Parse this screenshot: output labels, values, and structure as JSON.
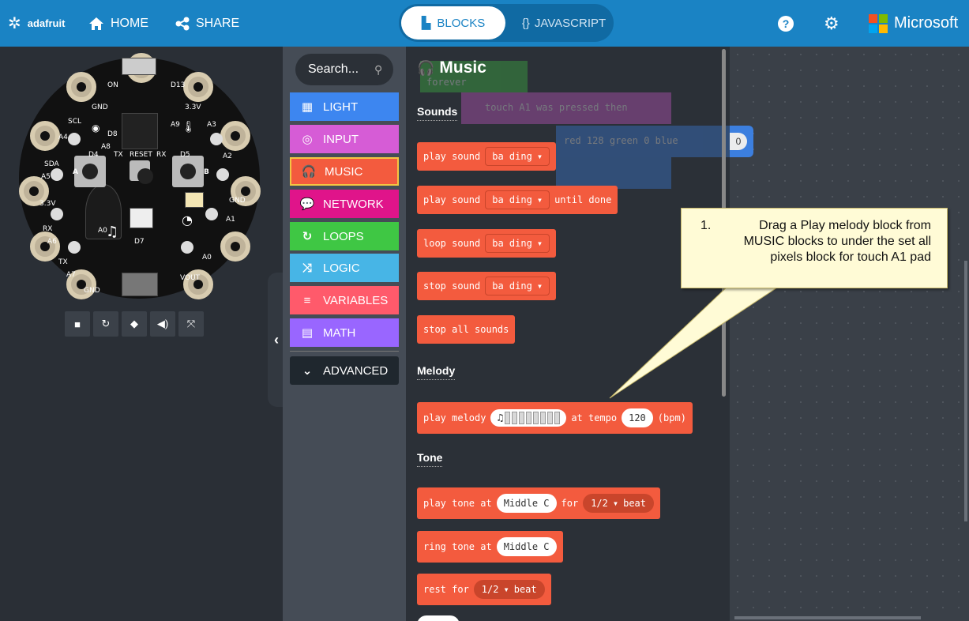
{
  "header": {
    "logo_text": "adafruit",
    "home_label": "HOME",
    "share_label": "SHARE",
    "blocks_tab": "BLOCKS",
    "javascript_tab": "JAVASCRIPT",
    "brand": "Microsoft",
    "colors": {
      "bar": "#1a83c4",
      "ms_red": "#f25022",
      "ms_green": "#7fba00",
      "ms_blue": "#00a4ef",
      "ms_yellow": "#ffb900"
    }
  },
  "simulator": {
    "labels": [
      "GND",
      "D8",
      "SCL",
      "A4",
      "SDA",
      "A5",
      "3.3V",
      "RX",
      "A6",
      "TX",
      "A7",
      "GND",
      "ON",
      "D13",
      "3.3V",
      "A3",
      "A2",
      "GND",
      "A1",
      "A0",
      "VOUT",
      "D4",
      "D5",
      "A8",
      "A9",
      "TX",
      "RESET",
      "RX",
      "A",
      "B",
      "D7",
      "A0"
    ],
    "controls": [
      "stop-icon",
      "restart-icon",
      "debug-icon",
      "sound-icon",
      "fullscreen-icon"
    ]
  },
  "toolbox": {
    "search_placeholder": "Search...",
    "categories": [
      {
        "label": "LIGHT",
        "icon": "grid-icon",
        "color": "#3d86f0"
      },
      {
        "label": "INPUT",
        "icon": "target-icon",
        "color": "#d65cd6"
      },
      {
        "label": "MUSIC",
        "icon": "headphones-icon",
        "color": "#f35b3e"
      },
      {
        "label": "NETWORK",
        "icon": "chat-icon",
        "color": "#e0148a"
      },
      {
        "label": "LOOPS",
        "icon": "loop-icon",
        "color": "#3fc744"
      },
      {
        "label": "LOGIC",
        "icon": "shuffle-icon",
        "color": "#47b5e6"
      },
      {
        "label": "VARIABLES",
        "icon": "list-icon",
        "color": "#ff5a6b"
      },
      {
        "label": "MATH",
        "icon": "calculator-icon",
        "color": "#9966ff"
      }
    ],
    "advanced_label": "ADVANCED"
  },
  "flyout": {
    "title": "Music",
    "sections": {
      "sounds": "Sounds",
      "melody": "Melody",
      "tone": "Tone"
    },
    "blocks": {
      "play_sound": {
        "text": "play sound",
        "value": "ba ding"
      },
      "play_sound_until": {
        "text": "play sound",
        "value": "ba ding",
        "suffix": "until done"
      },
      "loop_sound": {
        "text": "loop sound",
        "value": "ba ding"
      },
      "stop_sound": {
        "text": "stop sound",
        "value": "ba ding"
      },
      "stop_all": {
        "text": "stop all sounds"
      },
      "play_melody": {
        "text": "play melody",
        "tempo_label": "at tempo",
        "tempo": "120",
        "unit": "(bpm)"
      },
      "play_tone": {
        "text": "play tone at",
        "note": "Middle C",
        "for_label": "for",
        "beat": "1/2",
        "beat_label": "beat"
      },
      "ring_tone": {
        "text": "ring tone at",
        "note": "Middle C"
      },
      "rest": {
        "text": "rest for",
        "beat": "1/2",
        "beat_label": "beat"
      }
    }
  },
  "ghost": {
    "forever": "forever",
    "touch": "touch A1",
    "pressed": "was pressed",
    "then": "then",
    "red_label": "red",
    "red": "128",
    "green_label": "green",
    "green": "0",
    "blue_label": "blue",
    "blue": "0"
  },
  "callout": {
    "number": "1.",
    "text": "Drag a Play melody block from MUSIC blocks to under the set all pixels block for touch A1 pad"
  }
}
